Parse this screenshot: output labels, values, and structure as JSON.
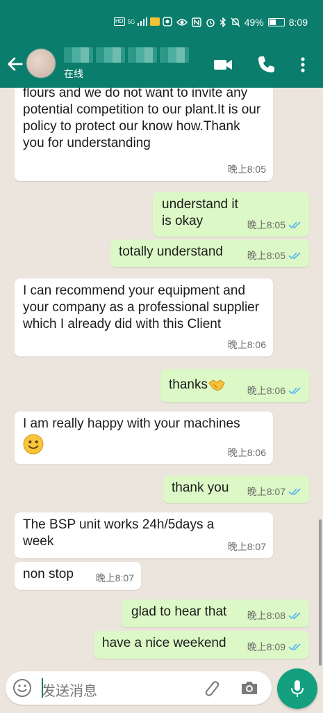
{
  "status_bar": {
    "battery": "49%",
    "battery_level": 0.49,
    "time": "8:09",
    "net_label": "HD",
    "signal_label": "5G"
  },
  "header": {
    "contact_status": "在线",
    "icons": [
      "back-arrow-icon",
      "video-call-icon",
      "phone-icon",
      "more-vert-icon"
    ],
    "color": "#0b7d6c"
  },
  "messages": [
    {
      "dir": "in",
      "text": "flours and we do not want to invite any potential competition to our plant.It is our policy to protect our know how.Thank you for understanding",
      "time": "晚上8:05"
    },
    {
      "dir": "out",
      "text": "understand it is okay",
      "time": "晚上8:05"
    },
    {
      "dir": "out",
      "text": "totally understand",
      "time": "晚上8:05"
    },
    {
      "dir": "in",
      "text": "I can recommend your equipment and your company as a professional supplier which I already did with this Client",
      "time": "晚上8:06"
    },
    {
      "dir": "out",
      "text": "thanks",
      "emoji": "handshake",
      "time": "晚上8:06"
    },
    {
      "dir": "in",
      "text": "I am really happy with your machines",
      "emoji": "smile",
      "time": "晚上8:06"
    },
    {
      "dir": "out",
      "text": "thank you",
      "time": "晚上8:07"
    },
    {
      "dir": "in",
      "text": "The BSP unit works 24h/5days a week",
      "time": "晚上8:07"
    },
    {
      "dir": "in",
      "text": "non stop",
      "time": "晚上8:07"
    },
    {
      "dir": "out",
      "text": "glad to hear that",
      "time": "晚上8:08"
    },
    {
      "dir": "out",
      "text": "have a nice weekend",
      "time": "晚上8:09"
    }
  ],
  "input": {
    "placeholder": "发送消息"
  },
  "colors": {
    "incoming": "#ffffff",
    "outgoing": "#dcf8c6",
    "read_ticks": "#4fb6ec",
    "fab": "#14a07e"
  }
}
